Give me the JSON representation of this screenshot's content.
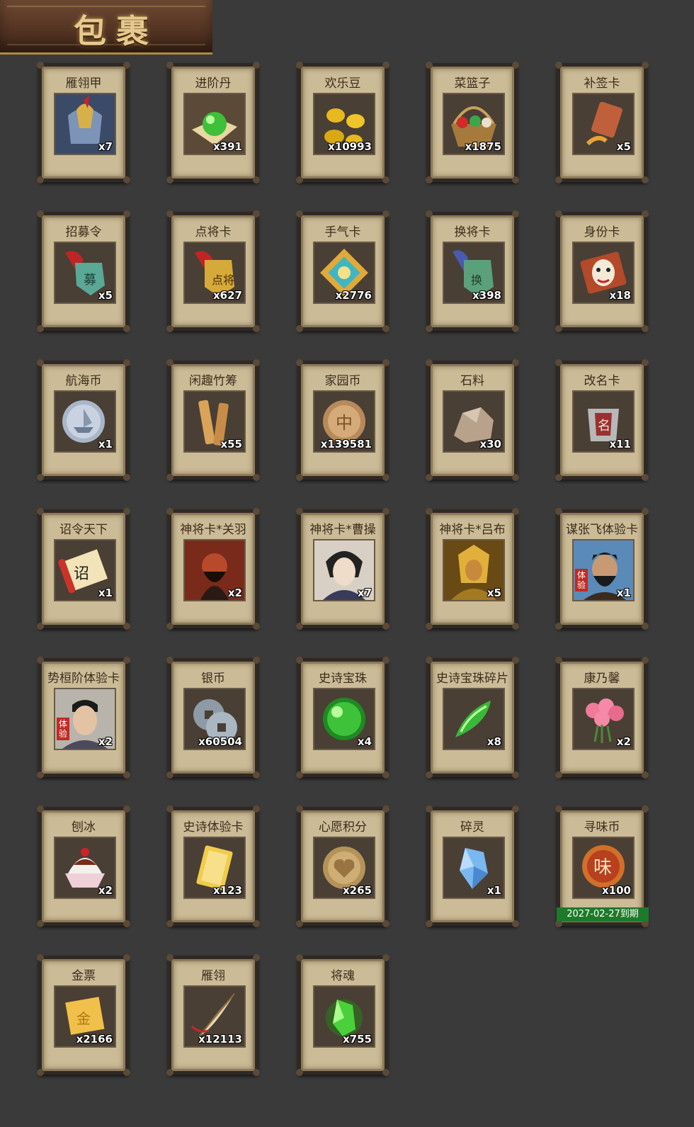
{
  "header": {
    "title": "包裹"
  },
  "items": [
    {
      "name": "雁翎甲",
      "qty": "x7",
      "icon": "armor-icon"
    },
    {
      "name": "进阶丹",
      "qty": "x391",
      "icon": "green-pill-icon"
    },
    {
      "name": "欢乐豆",
      "qty": "x10993",
      "icon": "gold-beans-icon"
    },
    {
      "name": "菜篮子",
      "qty": "x1875",
      "icon": "basket-icon"
    },
    {
      "name": "补签卡",
      "qty": "x5",
      "icon": "sign-card-icon"
    },
    {
      "name": "招募令",
      "qty": "x5",
      "icon": "recruit-token-icon"
    },
    {
      "name": "点将卡",
      "qty": "x627",
      "icon": "general-card-icon"
    },
    {
      "name": "手气卡",
      "qty": "x2776",
      "icon": "luck-card-icon"
    },
    {
      "name": "换将卡",
      "qty": "x398",
      "icon": "swap-card-icon"
    },
    {
      "name": "身份卡",
      "qty": "x18",
      "icon": "mask-card-icon"
    },
    {
      "name": "航海币",
      "qty": "x1",
      "icon": "silver-ship-coin-icon"
    },
    {
      "name": "闲趣竹筹",
      "qty": "x55",
      "icon": "bamboo-tally-icon"
    },
    {
      "name": "家园币",
      "qty": "x139581",
      "icon": "home-coin-icon"
    },
    {
      "name": "石料",
      "qty": "x30",
      "icon": "stone-icon"
    },
    {
      "name": "改名卡",
      "qty": "x11",
      "icon": "rename-card-icon"
    },
    {
      "name": "诏令天下",
      "qty": "x1",
      "icon": "edict-scroll-icon"
    },
    {
      "name": "神将卡*关羽",
      "qty": "x2",
      "icon": "guanyu-portrait-icon"
    },
    {
      "name": "神将卡*曹操",
      "qty": "x7",
      "icon": "caocao-portrait-icon"
    },
    {
      "name": "神将卡*吕布",
      "qty": "x5",
      "icon": "lubu-portrait-icon"
    },
    {
      "name": "谋张飞体验卡",
      "qty": "x1",
      "icon": "zhangfei-portrait-icon",
      "tag": "体验"
    },
    {
      "name": "势桓阶体验卡",
      "qty": "x2",
      "icon": "huanjie-portrait-icon",
      "tag": "体验"
    },
    {
      "name": "银币",
      "qty": "x60504",
      "icon": "silver-coins-icon"
    },
    {
      "name": "史诗宝珠",
      "qty": "x4",
      "icon": "green-orb-icon"
    },
    {
      "name": "史诗宝珠碎片",
      "qty": "x8",
      "icon": "green-shard-icon"
    },
    {
      "name": "康乃馨",
      "qty": "x2",
      "icon": "carnation-icon"
    },
    {
      "name": "刨冰",
      "qty": "x2",
      "icon": "shaved-ice-icon"
    },
    {
      "name": "史诗体验卡",
      "qty": "x123",
      "icon": "gold-card-icon"
    },
    {
      "name": "心愿积分",
      "qty": "x265",
      "icon": "heart-coin-icon"
    },
    {
      "name": "碎灵",
      "qty": "x1",
      "icon": "blue-crystal-icon"
    },
    {
      "name": "寻味币",
      "qty": "x100",
      "icon": "flavor-coin-icon",
      "expiry": "2027-02-27到期"
    },
    {
      "name": "金票",
      "qty": "x2166",
      "icon": "gold-ticket-icon"
    },
    {
      "name": "雁翎",
      "qty": "x12113",
      "icon": "feather-icon"
    },
    {
      "name": "将魂",
      "qty": "x755",
      "icon": "green-soul-icon"
    }
  ]
}
